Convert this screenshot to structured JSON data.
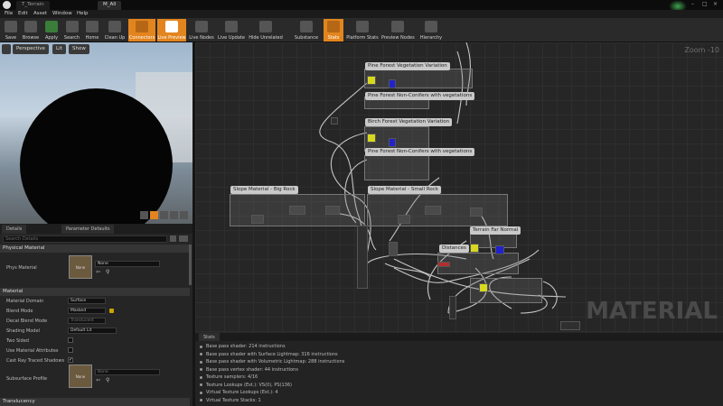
{
  "window": {
    "tabs": [
      "T_Terrain",
      "M_All"
    ],
    "controls": [
      "–",
      "□",
      "×"
    ]
  },
  "menu": [
    "File",
    "Edit",
    "Asset",
    "Window",
    "Help"
  ],
  "toolbar": [
    "Save",
    "Browse",
    "Apply",
    "Search",
    "Home",
    "Clean Up",
    "Connectors",
    "Live Preview",
    "Live Nodes",
    "Live Update",
    "Hide Unrelated",
    "Substance",
    "Stats",
    "Platform Stats",
    "Preview Nodes",
    "Hierarchy"
  ],
  "viewport": {
    "buttons": [
      "Perspective",
      "Lit",
      "Show"
    ]
  },
  "details": {
    "tabs": [
      "Details",
      "Parameter Defaults"
    ],
    "search_placeholder": "Search Details",
    "categories": [
      "Physical Material",
      "Material",
      "Translucency"
    ],
    "phys_material_label": "Phys Material",
    "phys_material_value": "None",
    "thumb_none": "None",
    "props": [
      {
        "label": "Material Domain",
        "value": "Surface"
      },
      {
        "label": "Blend Mode",
        "value": "Masked"
      },
      {
        "label": "Decal Blend Mode",
        "value": "Translucent"
      },
      {
        "label": "Shading Model",
        "value": "Default Lit"
      },
      {
        "label": "Two Sided",
        "value": ""
      },
      {
        "label": "Use Material Attributes",
        "value": ""
      },
      {
        "label": "Cast Ray Traced Shadows",
        "value": ""
      },
      {
        "label": "Subsurface Profile",
        "value": "None"
      }
    ]
  },
  "graph": {
    "zoom": "Zoom -10",
    "watermark": "MATERIAL",
    "comments": [
      "Pine Forest Vegetation Variation",
      "Pine Forest Non-Conifers with vegetations",
      "Birch Forest Vegetation Variation",
      "Pine Forest Non-Conifers with vegetations",
      "Slope Material - Big Rock",
      "Slope Material - Small Rock",
      "Terrain Far Normal",
      "Distances"
    ]
  },
  "stats": {
    "tab": "Stats",
    "lines": [
      "Base pass shader: 214 instructions",
      "Base pass shader with Surface Lightmap: 316 instructions",
      "Base pass shader with Volumetric Lightmap: 288 instructions",
      "Base pass vertex shader: 44 instructions",
      "Texture samplers: 4/16",
      "Texture Lookups (Est.): VS(0), PS(136)",
      "Virtual Texture Lookups (Est.): 4",
      "Virtual Texture Stacks: 1"
    ]
  }
}
